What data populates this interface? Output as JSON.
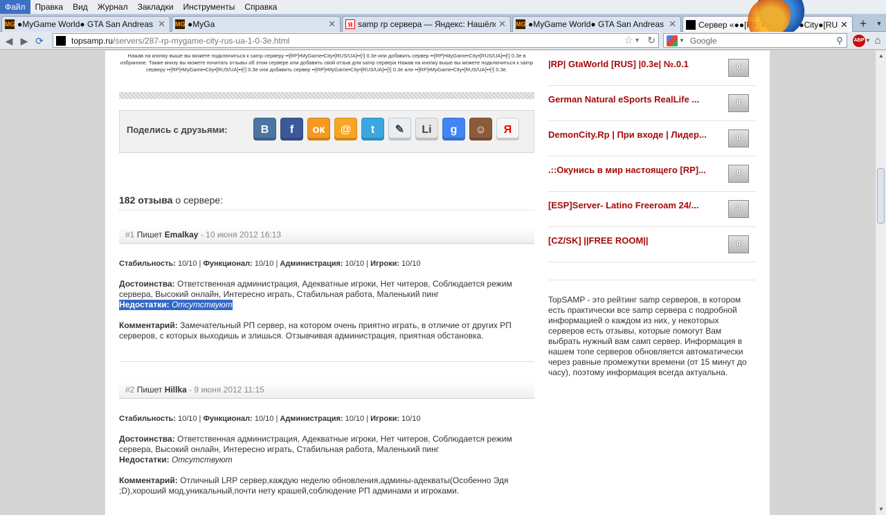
{
  "browser": {
    "menu": [
      "Файл",
      "Правка",
      "Вид",
      "Журнал",
      "Закладки",
      "Инструменты",
      "Справка"
    ],
    "tabs": [
      {
        "title": "●MyGame World● GTA San Andreas Mul...",
        "favicon": "mg",
        "favicon_text": "MG",
        "active": false
      },
      {
        "title": "●MyGa",
        "favicon": "mg",
        "favicon_text": "MG",
        "active": false
      },
      {
        "title": "samp rp сервера — Яндекс: Нашёлся ...",
        "favicon": "ya",
        "favicon_text": "Я",
        "active": false
      },
      {
        "title": "●MyGame World● GTA San Andreas Mul...",
        "favicon": "mg",
        "favicon_text": "MG",
        "active": false
      },
      {
        "title": "Сервер «●●[RP]●MyGame●City●[RUS/UA...",
        "favicon": "blk",
        "favicon_text": "",
        "active": true
      }
    ],
    "url_host": "topsamp.ru",
    "url_path": "/servers/287-rp-mygame-city-rus-ua-1-0-3e.html",
    "search_engine": "Google",
    "addon_label": "ABP"
  },
  "page": {
    "intro_text": "Нажав на кнопку выше вы можете подключиться к samp серверу ••[RP]•MyGame•City•[RUS/UA]••[!] 0.3e или добавить сервер ••[RP]•MyGame•City•[RUS/UA]••[!] 0.3e в избранное. Также внизу вы можете почитать отзывы об этом сервере или добавить свой отзыв для samp сервера Нажав на кнопку выше вы можете подключиться к samp серверу ••[RP]•MyGame•City•[RUS/UA]••[!] 0.3e или добавить сервер ••[RP]•MyGame•City•[RUS/UA]••[!] 0.3e или ••[RP]•MyGame•City•[RUS/UA]••[!] 0.3e.",
    "share": {
      "label": "Поделись с друзьями:",
      "buttons": [
        {
          "name": "vkontakte",
          "glyph": "В",
          "color": "#4c75a3"
        },
        {
          "name": "facebook",
          "glyph": "f",
          "color": "#3b5998"
        },
        {
          "name": "odnoklassniki",
          "glyph": "ок",
          "color": "#f59a20"
        },
        {
          "name": "mailru",
          "glyph": "@",
          "color": "#f5a623"
        },
        {
          "name": "twitter",
          "glyph": "t",
          "color": "#3aa7e0"
        },
        {
          "name": "livejournal",
          "glyph": "✎",
          "color": "#e9eef3"
        },
        {
          "name": "liveinternet",
          "glyph": "Li",
          "color": "#e8e8e8"
        },
        {
          "name": "google",
          "glyph": "g",
          "color": "#4285f4"
        },
        {
          "name": "moikrug",
          "glyph": "☺",
          "color": "#8a5a3b"
        },
        {
          "name": "yandex",
          "glyph": "Я",
          "color": "#f6f6f6"
        }
      ]
    },
    "reviews_heading": {
      "count": "182 отзыва",
      "suffix": " о сервере:"
    },
    "reviews": [
      {
        "num": "#1",
        "writes": "Пишет",
        "author": "Emalkay",
        "date": "- 10 июня 2012 16:13",
        "ratings": [
          {
            "label": "Стабильность:",
            "value": "10/10"
          },
          {
            "label": "Функционал:",
            "value": "10/10"
          },
          {
            "label": "Администрация:",
            "value": "10/10"
          },
          {
            "label": "Игроки:",
            "value": "10/10"
          }
        ],
        "pros_label": "Достоинства:",
        "pros": "Ответственная администрация, Адекватные игроки, Нет читеров, Соблюдается режим сервера, Высокий онлайн, Интересно играть, Стабильная работа, Маленький пинг",
        "cons_label": "Недостатки:",
        "cons": "Отсутствуют",
        "comment_label": "Комментарий:",
        "comment": "Замечательный РП сервер, на котором очень приятно играть, в отличие от других РП серверов, с которых выходишь и злишься. Отзывчивая администрация, приятная обстановка."
      },
      {
        "num": "#2",
        "writes": "Пишет",
        "author": "Hillka",
        "date": "- 9 июня 2012 11:15",
        "ratings": [
          {
            "label": "Стабильность:",
            "value": "10/10"
          },
          {
            "label": "Функционал:",
            "value": "10/10"
          },
          {
            "label": "Администрация:",
            "value": "10/10"
          },
          {
            "label": "Игроки:",
            "value": "10/10"
          }
        ],
        "pros_label": "Достоинства:",
        "pros": "Ответственная администрация, Адекватные игроки, Нет читеров, Соблюдается режим сервера, Высокий онлайн, Интересно играть, Стабильная работа, Маленький пинг",
        "cons_label": "Недостатки:",
        "cons": "Отсутствуют",
        "comment_label": "Комментарий:",
        "comment": "Отличный LRP сервер,каждую неделю обновления,админы-адекваты(Особенно Эдя ;D),хороший мод,уникальный,почти нету крашей,соблюдение РП админами и игроками."
      }
    ],
    "sidebar": {
      "servers": [
        {
          "name": "|RP| GtaWorld [RUS] |0.3e| №.0.1",
          "votes": "0"
        },
        {
          "name": "German Natural eSports RealLife ...",
          "votes": "0"
        },
        {
          "name": "DemonCity.Rp | При входе | Лидер...",
          "votes": "0"
        },
        {
          "name": ".::Окунись в мир настоящего [RP]...",
          "votes": "0"
        },
        {
          "name": "[ESP]Server- Latino Freeroam 24/...",
          "votes": "0"
        },
        {
          "name": "[CZ/SK] ||FREE ROOM||",
          "votes": "0"
        }
      ],
      "about": "TopSAMP - это рейтинг samp серверов, в котором есть практически все samp сервера с подробной информацией о каждом из них, у некоторых серверов есть отзывы, которые помогут Вам выбрать нужный вам самп сервер. Информация в нашем топе серверов обновляется автоматически через равные промежутки времени (от 15 минут до часу), поэтому информация всегда актуальна."
    }
  }
}
